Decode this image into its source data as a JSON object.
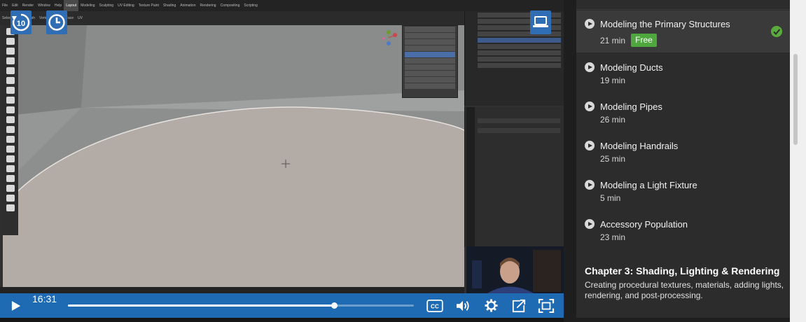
{
  "player": {
    "current_time": "16:31",
    "progress_fraction": 0.77,
    "rewind_badge": "10",
    "icons": {
      "rewind": "rewind-10-icon",
      "clock": "clock-icon",
      "screen": "laptop-icon",
      "play": "play-icon",
      "cc": "closed-captions-icon",
      "volume": "volume-icon",
      "settings": "gear-icon",
      "share": "share-icon",
      "fullscreen": "fullscreen-icon"
    },
    "cc_label": "CC",
    "colors": {
      "control_bar": "#1e6ab3",
      "overlay_button": "#2f6db5"
    }
  },
  "course": {
    "lessons": [
      {
        "title": "Modeling the Primary Structures",
        "duration": "21 min",
        "badge": "Free",
        "completed": true,
        "current": true
      },
      {
        "title": "Modeling Ducts",
        "duration": "19 min"
      },
      {
        "title": "Modeling Pipes",
        "duration": "26 min"
      },
      {
        "title": "Modeling Handrails",
        "duration": "25 min"
      },
      {
        "title": "Modeling a Light Fixture",
        "duration": "5 min"
      },
      {
        "title": "Accessory Population",
        "duration": "23 min"
      }
    ],
    "chapter": {
      "title": "Chapter 3:  Shading, Lighting & Rendering",
      "description": "Creating procedural textures, materials, adding lights, rendering, and post-processing."
    },
    "colors": {
      "free_badge": "#4fa83d",
      "check": "#5aaa3e"
    }
  }
}
